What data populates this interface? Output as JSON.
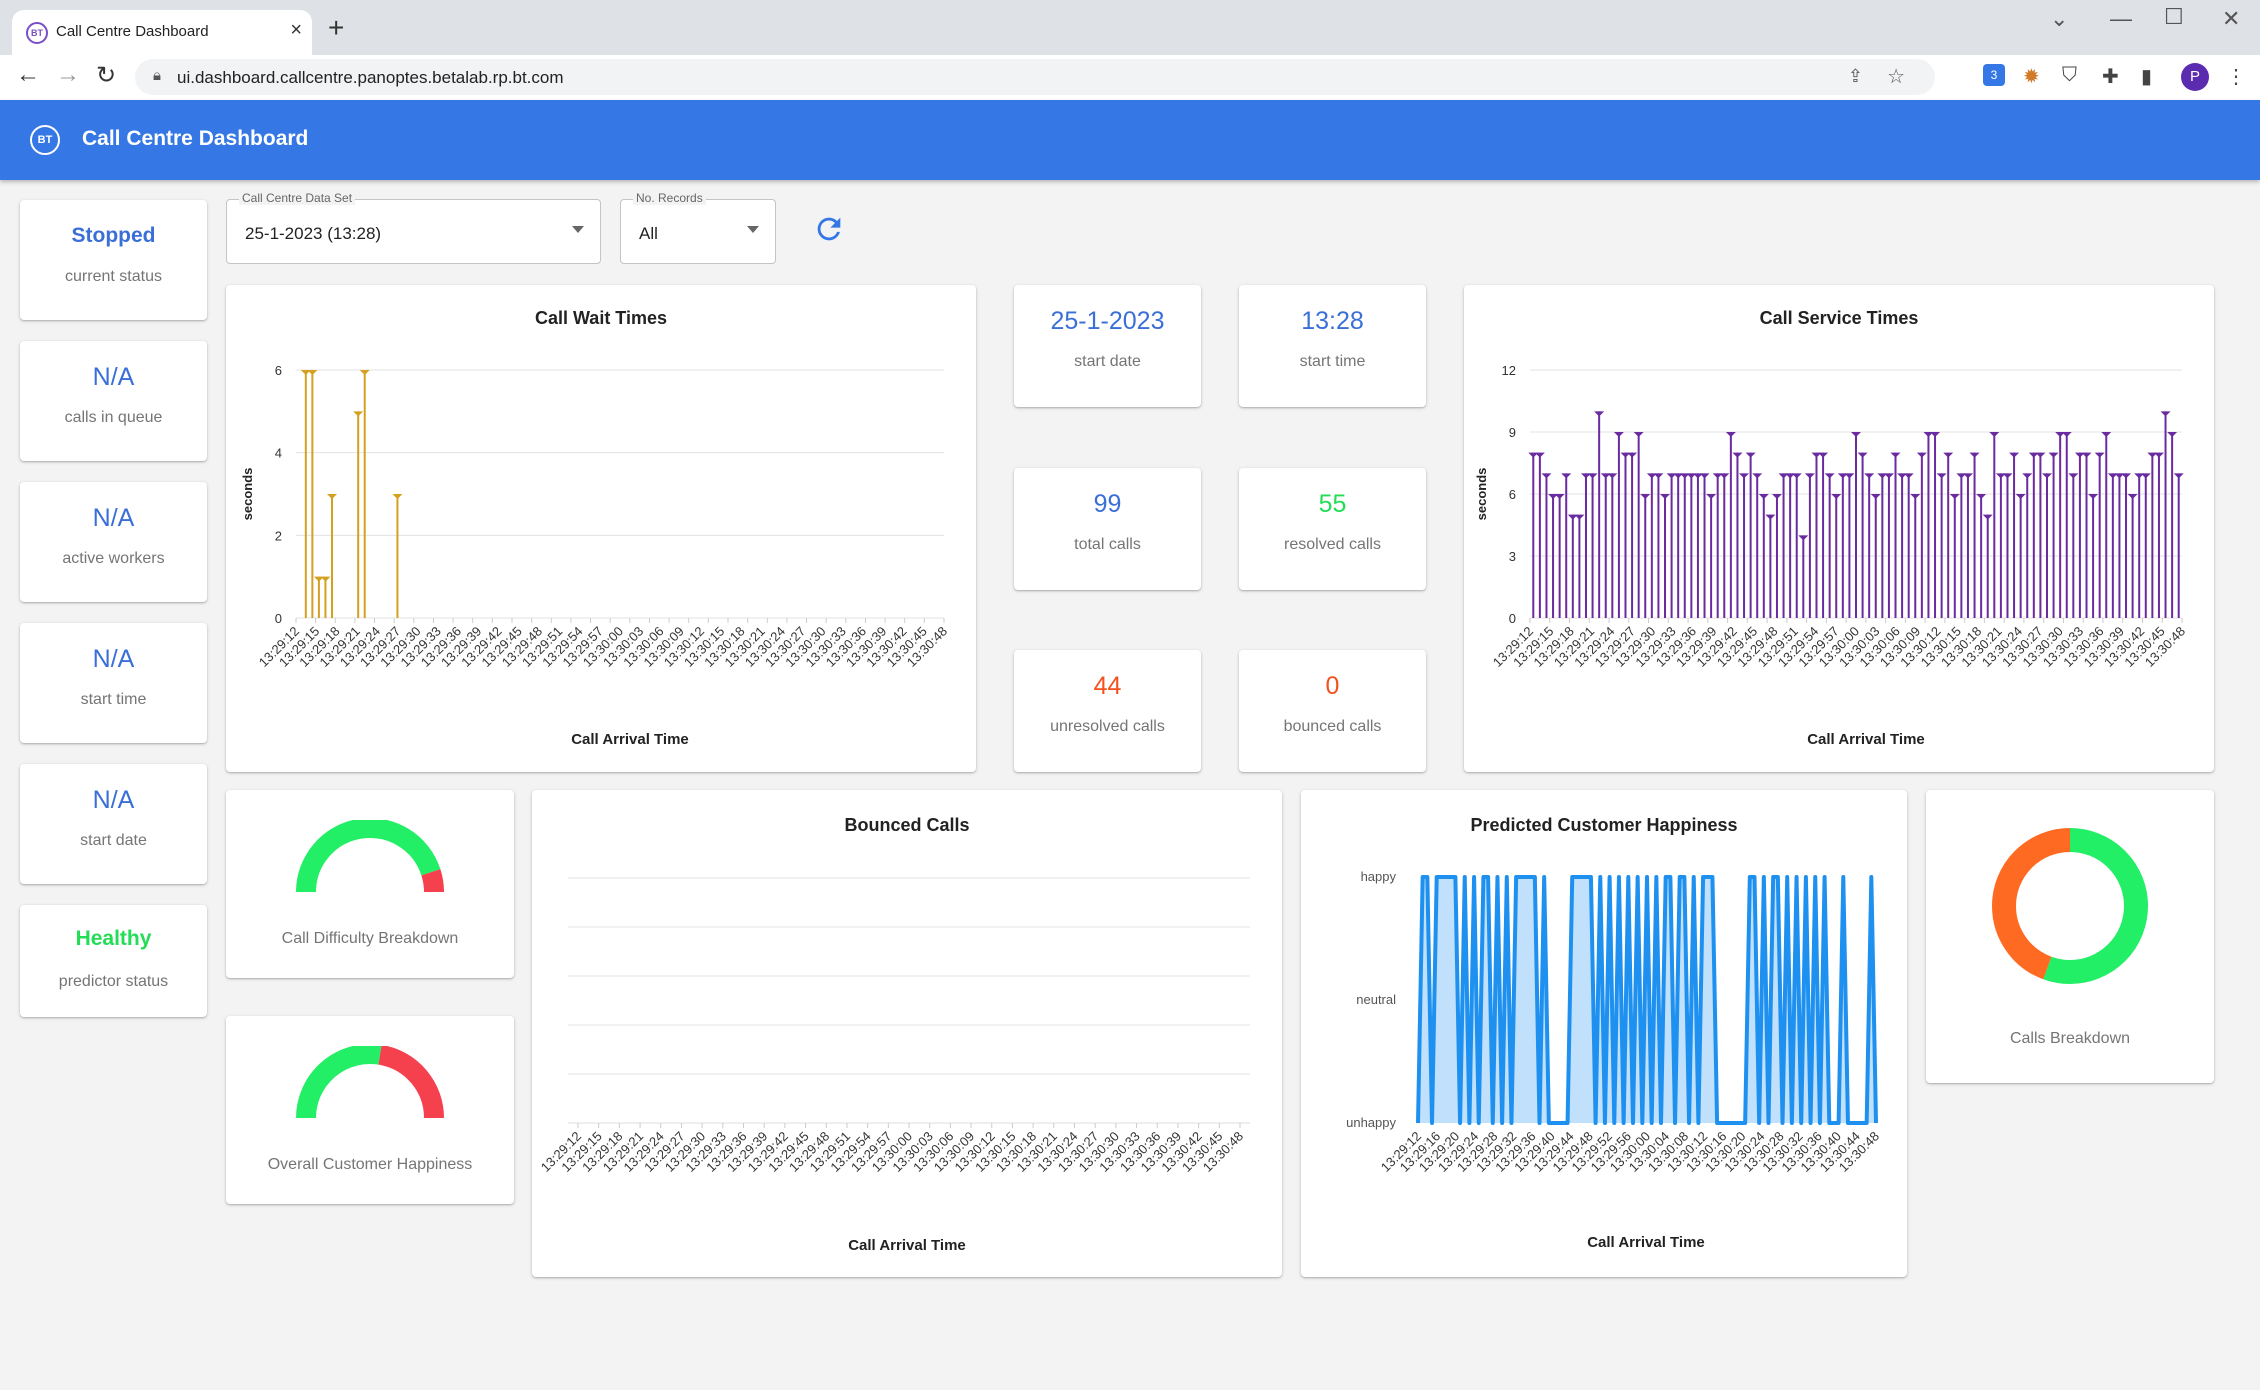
{
  "browser": {
    "tab_title": "Call Centre Dashboard",
    "favicon": "BT",
    "url": "ui.dashboard.callcentre.panoptes.betalab.rp.bt.com",
    "profile_initial": "P",
    "extension_badge": "3"
  },
  "app": {
    "logo": "BT",
    "title": "Call Centre Dashboard"
  },
  "sidebar": [
    {
      "value": "Stopped",
      "label": "current status",
      "color": "#3a6fd8"
    },
    {
      "value": "N/A",
      "label": "calls in queue",
      "color": "#3a6fd8"
    },
    {
      "value": "N/A",
      "label": "active workers",
      "color": "#3a6fd8"
    },
    {
      "value": "N/A",
      "label": "start time",
      "color": "#3a6fd8"
    },
    {
      "value": "N/A",
      "label": "start date",
      "color": "#3a6fd8"
    },
    {
      "value": "Healthy",
      "label": "predictor status",
      "color": "#22dd55"
    }
  ],
  "controls": {
    "dataset": {
      "label": "Call Centre Data Set",
      "value": "25-1-2023  (13:28)"
    },
    "records": {
      "label": "No. Records",
      "value": "All"
    }
  },
  "stats": [
    {
      "value": "25-1-2023",
      "label": "start date",
      "color": "#3a6fd8"
    },
    {
      "value": "13:28",
      "label": "start time",
      "color": "#3a6fd8"
    },
    {
      "value": "99",
      "label": "total calls",
      "color": "#3a6fd8"
    },
    {
      "value": "55",
      "label": "resolved calls",
      "color": "#22dd55"
    },
    {
      "value": "44",
      "label": "unresolved calls",
      "color": "#f4511e"
    },
    {
      "value": "0",
      "label": "bounced calls",
      "color": "#f4511e"
    }
  ],
  "gauges": [
    {
      "label": "Call Difficulty Breakdown",
      "fraction_green": 0.9
    },
    {
      "label": "Overall Customer Happiness",
      "fraction_green": 0.55
    }
  ],
  "donut": {
    "label": "Calls Breakdown",
    "resolved": 55,
    "unresolved": 44,
    "colors": {
      "resolved": "#22ee66",
      "unresolved": "#ff6a22"
    }
  },
  "chart_data": [
    {
      "id": "wait",
      "type": "bar",
      "title": "Call Wait Times",
      "xlabel": "Call Arrival Time",
      "ylabel": "seconds",
      "ylim": [
        0,
        6
      ],
      "yticks": [
        0,
        2,
        4,
        6
      ],
      "color": "#d4a020",
      "categories": [
        "13:29:12",
        "13:29:15",
        "13:29:18",
        "13:29:21",
        "13:29:24",
        "13:29:27",
        "13:29:30",
        "13:29:33",
        "13:29:36",
        "13:29:39",
        "13:29:42",
        "13:29:45",
        "13:29:48",
        "13:29:51",
        "13:29:54",
        "13:29:57",
        "13:30:00",
        "13:30:03",
        "13:30:06",
        "13:30:09",
        "13:30:12",
        "13:30:15",
        "13:30:18",
        "13:30:21",
        "13:30:24",
        "13:30:27",
        "13:30:30",
        "13:30:33",
        "13:30:36",
        "13:30:39",
        "13:30:42",
        "13:30:45",
        "13:30:48"
      ],
      "values": [
        0,
        6,
        6,
        1,
        1,
        3,
        0,
        0,
        0,
        5,
        6,
        0,
        0,
        0,
        0,
        3,
        0,
        0,
        0,
        0,
        0,
        0,
        0,
        0,
        0,
        0,
        0,
        0,
        0,
        0,
        0,
        0,
        0,
        0,
        0,
        0,
        0,
        0,
        0,
        0,
        0,
        0,
        0,
        0,
        0,
        0,
        0,
        0,
        0,
        0,
        0,
        0,
        0,
        0,
        0,
        0,
        0,
        0,
        0,
        0,
        0,
        0,
        0,
        0,
        0,
        0,
        0,
        0,
        0,
        0,
        0,
        0,
        0,
        0,
        0,
        0,
        0,
        0,
        0,
        0,
        0,
        0,
        0,
        0,
        0,
        0,
        0,
        0,
        0,
        0,
        0,
        0,
        0,
        0,
        0,
        0,
        0,
        0,
        0
      ]
    },
    {
      "id": "service",
      "type": "bar",
      "title": "Call Service Times",
      "xlabel": "Call Arrival Time",
      "ylabel": "seconds",
      "ylim": [
        0,
        12
      ],
      "yticks": [
        0,
        3,
        6,
        9,
        12
      ],
      "color": "#6a2aa0",
      "categories": [
        "13:29:12",
        "13:29:15",
        "13:29:18",
        "13:29:21",
        "13:29:24",
        "13:29:27",
        "13:29:30",
        "13:29:33",
        "13:29:36",
        "13:29:39",
        "13:29:42",
        "13:29:45",
        "13:29:48",
        "13:29:51",
        "13:29:54",
        "13:29:57",
        "13:30:00",
        "13:30:03",
        "13:30:06",
        "13:30:09",
        "13:30:12",
        "13:30:15",
        "13:30:18",
        "13:30:21",
        "13:30:24",
        "13:30:27",
        "13:30:30",
        "13:30:33",
        "13:30:36",
        "13:30:39",
        "13:30:42",
        "13:30:45",
        "13:30:48"
      ],
      "values": [
        8,
        8,
        7,
        6,
        6,
        7,
        5,
        5,
        7,
        7,
        10,
        7,
        7,
        9,
        8,
        8,
        9,
        6,
        7,
        7,
        6,
        7,
        7,
        7,
        7,
        7,
        7,
        6,
        7,
        7,
        9,
        8,
        7,
        8,
        7,
        6,
        5,
        6,
        7,
        7,
        7,
        4,
        7,
        8,
        8,
        7,
        6,
        7,
        7,
        9,
        8,
        7,
        6,
        7,
        7,
        8,
        7,
        7,
        6,
        8,
        9,
        9,
        7,
        8,
        6,
        7,
        7,
        8,
        6,
        5,
        9,
        7,
        7,
        8,
        6,
        7,
        8,
        8,
        7,
        8,
        9,
        9,
        7,
        8,
        8,
        6,
        8,
        9,
        7,
        7,
        7,
        6,
        7,
        7,
        8,
        8,
        10,
        9,
        7
      ]
    },
    {
      "id": "bounced",
      "type": "bar",
      "title": "Bounced Calls",
      "xlabel": "Call Arrival Time",
      "color": "#3578e5",
      "categories": [
        "13:29:12",
        "13:29:15",
        "13:29:18",
        "13:29:21",
        "13:29:24",
        "13:29:27",
        "13:29:30",
        "13:29:33",
        "13:29:36",
        "13:29:39",
        "13:29:42",
        "13:29:45",
        "13:29:48",
        "13:29:51",
        "13:29:54",
        "13:29:57",
        "13:30:00",
        "13:30:03",
        "13:30:06",
        "13:30:09",
        "13:30:12",
        "13:30:15",
        "13:30:18",
        "13:30:21",
        "13:30:24",
        "13:30:27",
        "13:30:30",
        "13:30:33",
        "13:30:36",
        "13:30:39",
        "13:30:42",
        "13:30:45",
        "13:30:48"
      ],
      "grid": true
    },
    {
      "id": "happiness",
      "type": "area",
      "title": "Predicted Customer Happiness",
      "xlabel": "Call Arrival Time",
      "ylevels": [
        "unhappy",
        "neutral",
        "happy"
      ],
      "color": "#1e90f0",
      "categories": [
        "13:29:12",
        "13:29:16",
        "13:29:20",
        "13:29:24",
        "13:29:28",
        "13:29:32",
        "13:29:36",
        "13:29:40",
        "13:29:44",
        "13:29:48",
        "13:29:52",
        "13:29:56",
        "13:30:00",
        "13:30:04",
        "13:30:08",
        "13:30:12",
        "13:30:16",
        "13:30:20",
        "13:30:24",
        "13:30:28",
        "13:30:32",
        "13:30:36",
        "13:30:40",
        "13:30:44",
        "13:30:48"
      ],
      "values": [
        0,
        2,
        2,
        0,
        2,
        2,
        2,
        2,
        2,
        0,
        2,
        0,
        2,
        0,
        2,
        2,
        0,
        2,
        0,
        2,
        0,
        2,
        2,
        2,
        2,
        2,
        0,
        2,
        0,
        0,
        0,
        0,
        0,
        2,
        2,
        2,
        2,
        2,
        0,
        2,
        0,
        2,
        0,
        2,
        0,
        2,
        0,
        2,
        0,
        2,
        0,
        2,
        0,
        2,
        2,
        0,
        2,
        2,
        0,
        2,
        0,
        2,
        2,
        2,
        0,
        0,
        0,
        0,
        0,
        0,
        0,
        2,
        2,
        0,
        2,
        0,
        2,
        2,
        0,
        2,
        0,
        2,
        0,
        2,
        0,
        2,
        0,
        2,
        0,
        0,
        0,
        2,
        0,
        0,
        0,
        0,
        0,
        2,
        0
      ]
    }
  ]
}
